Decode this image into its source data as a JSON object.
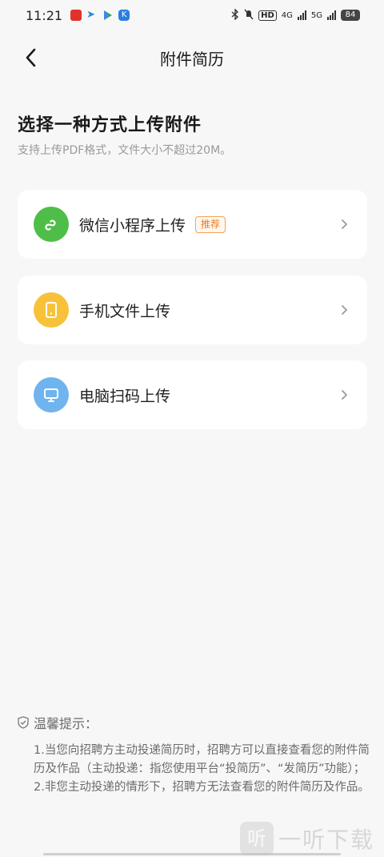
{
  "status_bar": {
    "time": "11:21",
    "network_1": "4G",
    "network_2": "5G",
    "battery": "84",
    "hd": "HD"
  },
  "nav": {
    "title": "附件简历"
  },
  "heading": "选择一种方式上传附件",
  "subheading": "支持上传PDF格式，文件大小不超过20M。",
  "options": [
    {
      "label": "微信小程序上传",
      "badge": "推荐",
      "icon": "wechat-mini-program-icon",
      "color": "#4fbe48"
    },
    {
      "label": "手机文件上传",
      "icon": "phone-icon",
      "color": "#f7c23a"
    },
    {
      "label": "电脑扫码上传",
      "icon": "computer-icon",
      "color": "#6fb4ef"
    }
  ],
  "tips": {
    "title": "温馨提示：",
    "line1": "1.当您向招聘方主动投递简历时，招聘方可以直接查看您的附件简历及作品（主动投递：指您使用平台“投简历”、“发简历”功能）；",
    "line2": "2.非您主动投递的情形下，招聘方无法查看您的附件简历及作品。"
  },
  "watermark": {
    "glyph": "听",
    "text": "一听下载"
  }
}
